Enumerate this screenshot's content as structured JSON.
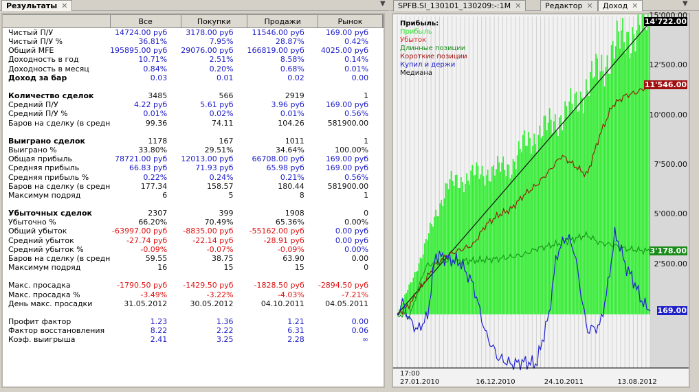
{
  "tabs_left": [
    {
      "label": "Результаты",
      "active": true
    }
  ],
  "tabs_right": [
    {
      "label": "SPFB.SI_130101_130209:-:1M"
    },
    {
      "label": "Редактор"
    },
    {
      "label": "Доход",
      "active": true
    }
  ],
  "close_glyph": "✕",
  "menu_glyph": "▼",
  "results": {
    "columns": [
      "Все",
      "Покупки",
      "Продажи",
      "Рынок"
    ],
    "rows": [
      {
        "label": "Чистый П/У",
        "values": [
          "14724.00 руб",
          "3178.00 руб",
          "11546.00 руб",
          "169.00 руб"
        ],
        "color": "blue"
      },
      {
        "label": "Чистый П/У %",
        "values": [
          "36.81%",
          "7.95%",
          "28.87%",
          "0.42%"
        ],
        "color": "blue"
      },
      {
        "label": "Общий MFE",
        "values": [
          "195895.00 руб",
          "29076.00 руб",
          "166819.00 руб",
          "4025.00 руб"
        ],
        "color": "blue"
      },
      {
        "label": "Доходность в год",
        "values": [
          "10.71%",
          "2.51%",
          "8.58%",
          "0.14%"
        ],
        "color": "blue"
      },
      {
        "label": "Доходность в месяц",
        "values": [
          "0.84%",
          "0.20%",
          "0.68%",
          "0.01%"
        ],
        "color": "blue"
      },
      {
        "label": "Доход за бар",
        "values": [
          "0.03",
          "0.01",
          "0.02",
          "0.00"
        ],
        "color": "blue",
        "bold": true
      },
      {
        "gap": true
      },
      {
        "label": "Количество сделок",
        "values": [
          "3485",
          "566",
          "2919",
          "1"
        ],
        "color": "blk",
        "bold": true
      },
      {
        "label": "Средний П/У",
        "values": [
          "4.22 руб",
          "5.61 руб",
          "3.96 руб",
          "169.00 руб"
        ],
        "color": "blue"
      },
      {
        "label": "Средний П/У %",
        "values": [
          "0.01%",
          "0.02%",
          "0.01%",
          "0.56%"
        ],
        "color": "blue"
      },
      {
        "label": "Баров на сделку (в среднем)",
        "values": [
          "99.36",
          "74.11",
          "104.26",
          "581900.00"
        ],
        "color": "blk"
      },
      {
        "gap": true
      },
      {
        "label": "Выиграно сделок",
        "values": [
          "1178",
          "167",
          "1011",
          "1"
        ],
        "color": "blk",
        "bold": true
      },
      {
        "label": "Выиграно %",
        "values": [
          "33.80%",
          "29.51%",
          "34.64%",
          "100.00%"
        ],
        "color": "blk"
      },
      {
        "label": "Общая прибыль",
        "values": [
          "78721.00 руб",
          "12013.00 руб",
          "66708.00 руб",
          "169.00 руб"
        ],
        "color": "blue"
      },
      {
        "label": "Средняя прибыль",
        "values": [
          "66.83 руб",
          "71.93 руб",
          "65.98 руб",
          "169.00 руб"
        ],
        "color": "blue"
      },
      {
        "label": "Средняя прибыль %",
        "values": [
          "0.22%",
          "0.24%",
          "0.21%",
          "0.56%"
        ],
        "color": "blue"
      },
      {
        "label": "Баров на сделку (в среднем)",
        "values": [
          "177.34",
          "158.57",
          "180.44",
          "581900.00"
        ],
        "color": "blk"
      },
      {
        "label": "Максимум подряд",
        "values": [
          "6",
          "5",
          "8",
          "1"
        ],
        "color": "blk"
      },
      {
        "gap": true
      },
      {
        "label": "Убыточных сделок",
        "values": [
          "2307",
          "399",
          "1908",
          "0"
        ],
        "color": "blk",
        "bold": true
      },
      {
        "label": "Убыточно %",
        "values": [
          "66.20%",
          "70.49%",
          "65.36%",
          "0.00%"
        ],
        "color": "blk"
      },
      {
        "label": "Общий убыток",
        "values": [
          "-63997.00 руб",
          "-8835.00 руб",
          "-55162.00 руб",
          "0.00 руб"
        ],
        "color": "red",
        "last": "blue"
      },
      {
        "label": "Средний убыток",
        "values": [
          "-27.74 руб",
          "-22.14 руб",
          "-28.91 руб",
          "0.00 руб"
        ],
        "color": "red",
        "last": "blue"
      },
      {
        "label": "Средний убыток %",
        "values": [
          "-0.09%",
          "-0.07%",
          "-0.09%",
          "0.00%"
        ],
        "color": "red",
        "last": "blue"
      },
      {
        "label": "Баров на сделку (в среднем)",
        "values": [
          "59.55",
          "38.75",
          "63.90",
          "0.00"
        ],
        "color": "blk"
      },
      {
        "label": "Максимум подряд",
        "values": [
          "16",
          "15",
          "15",
          "0"
        ],
        "color": "blk"
      },
      {
        "gap": true
      },
      {
        "label": "Макс. просадка",
        "values": [
          "-1790.50 руб",
          "-1429.50 руб",
          "-1828.50 руб",
          "-2894.50 руб"
        ],
        "color": "red"
      },
      {
        "label": "Макс. просадка %",
        "values": [
          "-3.49%",
          "-3.22%",
          "-4.03%",
          "-7.21%"
        ],
        "color": "red"
      },
      {
        "label": "День макс. просадки",
        "values": [
          "31.05.2012",
          "30.05.2012",
          "04.10.2011",
          "04.05.2011"
        ],
        "color": "blk"
      },
      {
        "gap": true
      },
      {
        "label": "Профит фактор",
        "values": [
          "1.23",
          "1.36",
          "1.21",
          "0.00"
        ],
        "color": "blue"
      },
      {
        "label": "Фактор восстановления",
        "values": [
          "8.22",
          "2.22",
          "6.31",
          "0.06"
        ],
        "color": "blue"
      },
      {
        "label": "Коэф. выигрыша",
        "values": [
          "2.41",
          "3.25",
          "2.28",
          "∞"
        ],
        "color": "blue"
      }
    ]
  },
  "chart_data": {
    "type": "line",
    "title": "Прибыль:",
    "legend": [
      {
        "name": "Прибыль",
        "color": "#33e033"
      },
      {
        "name": "Убыток",
        "color": "#e02020"
      },
      {
        "name": "Длинные позиции",
        "color": "#1a8c1a"
      },
      {
        "name": "Короткие позиции",
        "color": "#a01010"
      },
      {
        "name": "Купил и держи",
        "color": "#2020c8"
      },
      {
        "name": "Медиана",
        "color": "#111111"
      }
    ],
    "ylim": [
      -2700,
      15000
    ],
    "yticks": [
      {
        "v": 15000,
        "label": "15'000.00"
      },
      {
        "v": 12500,
        "label": "12'500.00"
      },
      {
        "v": 10000,
        "label": "10'000.00"
      },
      {
        "v": 7500,
        "label": "7'500.00"
      },
      {
        "v": 5000,
        "label": "5'000.00"
      },
      {
        "v": 2500,
        "label": "2'500.00"
      }
    ],
    "xlabels": [
      {
        "t": 0,
        "label": "17:00",
        "sub": "27.01.2010"
      },
      {
        "t": 0.3,
        "label": "16.12.2010"
      },
      {
        "t": 0.57,
        "label": "24.10.2011"
      },
      {
        "t": 0.86,
        "label": "13.08.2012"
      }
    ],
    "last_values": [
      {
        "v": 14722,
        "label": "14'722.00",
        "color": "#000000"
      },
      {
        "v": 11546,
        "label": "11'546.00",
        "color": "#a01010"
      },
      {
        "v": 3178,
        "label": "3'178.00",
        "color": "#1a8c1a"
      },
      {
        "v": 169,
        "label": "169.00",
        "color": "#2020c8"
      }
    ],
    "series": [
      {
        "name": "Прибыль",
        "x": [
          0,
          0.05,
          0.1,
          0.15,
          0.2,
          0.3,
          0.4,
          0.45,
          0.5,
          0.55,
          0.6,
          0.65,
          0.7,
          0.75,
          0.8,
          0.85,
          0.9,
          0.95,
          1
        ],
        "y": [
          0,
          1500,
          3000,
          5000,
          6500,
          7000,
          7300,
          7500,
          8500,
          9000,
          9500,
          10000,
          10500,
          11500,
          12300,
          13200,
          14000,
          14300,
          14700
        ]
      },
      {
        "name": "Медиана",
        "x": [
          0,
          1
        ],
        "y": [
          0,
          14722
        ]
      },
      {
        "name": "Короткие позиции",
        "x": [
          0,
          0.05,
          0.1,
          0.15,
          0.2,
          0.3,
          0.35,
          0.4,
          0.45,
          0.5,
          0.55,
          0.6,
          0.65,
          0.7,
          0.75,
          0.8,
          0.85,
          0.9,
          0.95,
          1
        ],
        "y": [
          0,
          500,
          1500,
          2500,
          3000,
          3500,
          4500,
          5000,
          5300,
          6000,
          6500,
          7200,
          8000,
          7500,
          7000,
          9000,
          10500,
          11000,
          11200,
          11546
        ]
      },
      {
        "name": "Длинные позиции",
        "x": [
          0,
          0.05,
          0.1,
          0.12,
          0.2,
          0.3,
          0.4,
          0.5,
          0.55,
          0.65,
          0.7,
          0.75,
          0.8,
          0.85,
          0.9,
          1
        ],
        "y": [
          0,
          -100,
          2000,
          2500,
          2700,
          2700,
          2800,
          3000,
          3300,
          3600,
          3800,
          4000,
          3600,
          3500,
          3300,
          3178
        ]
      },
      {
        "name": "Купил и держи",
        "x": [
          0,
          0.02,
          0.05,
          0.08,
          0.12,
          0.15,
          0.2,
          0.25,
          0.3,
          0.35,
          0.4,
          0.45,
          0.5,
          0.55,
          0.6,
          0.63,
          0.67,
          0.7,
          0.75,
          0.8,
          0.83,
          0.86,
          0.88,
          0.9,
          0.93,
          0.97,
          1
        ],
        "y": [
          0,
          600,
          -300,
          -800,
          -100,
          3000,
          2800,
          2600,
          1500,
          -1000,
          -2200,
          -2500,
          -2400,
          -2500,
          0,
          3000,
          4000,
          3200,
          -800,
          -600,
          1200,
          4000,
          3500,
          2500,
          1800,
          600,
          169
        ]
      }
    ]
  }
}
